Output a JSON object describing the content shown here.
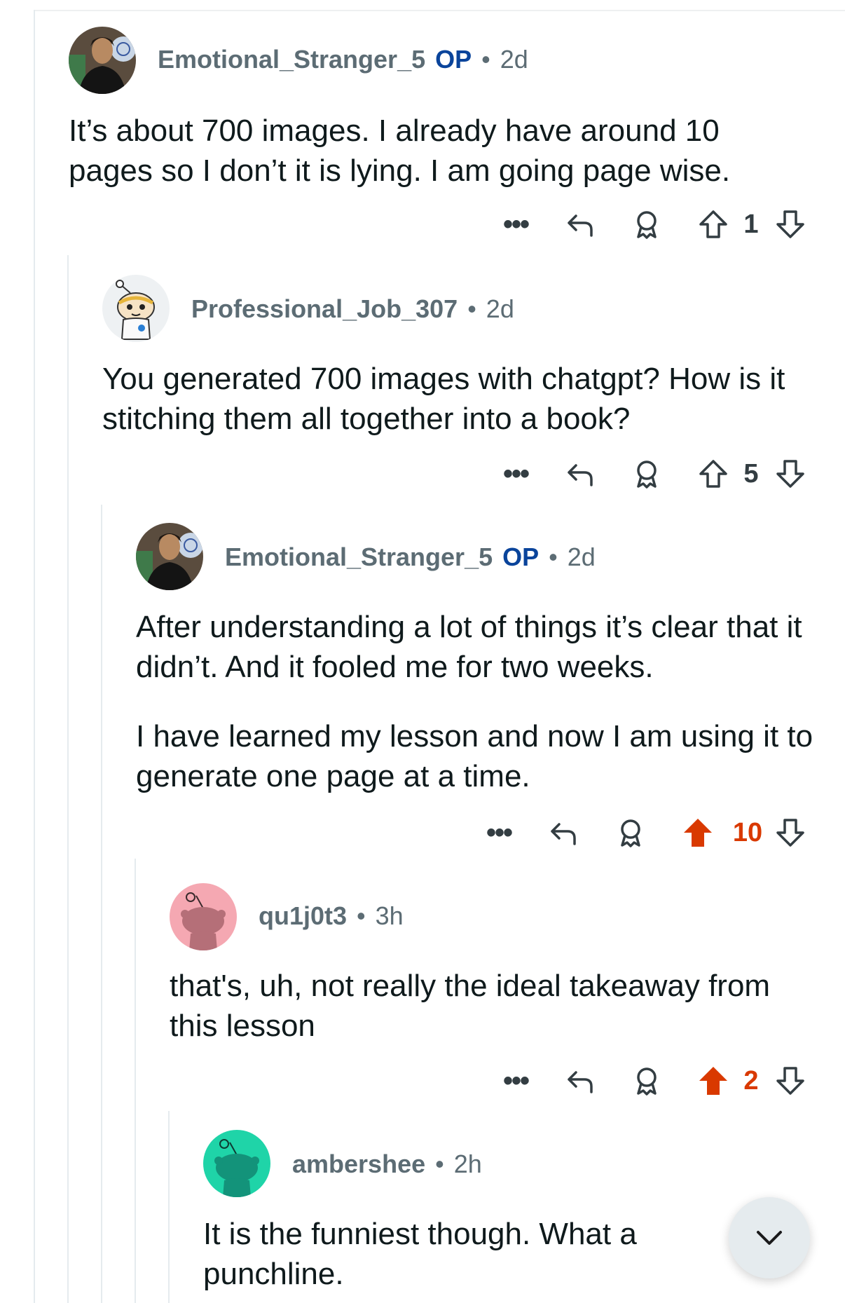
{
  "comments": [
    {
      "author": "Emotional_Stranger_5",
      "op_label": "OP",
      "separator": "•",
      "age": "2d",
      "avatar": "profile-photo",
      "paragraphs": [
        "It’s about 700 images. I already have around 10 pages so I don’t it is lying. I am going page wise."
      ],
      "score": "1",
      "upvoted": false
    },
    {
      "author": "Professional_Job_307",
      "op_label": "",
      "separator": "•",
      "age": "2d",
      "avatar": "snoo-avatar",
      "paragraphs": [
        "You generated 700 images with chatgpt? How is it stitching them all together into a book?"
      ],
      "score": "5",
      "upvoted": false
    },
    {
      "author": "Emotional_Stranger_5",
      "op_label": "OP",
      "separator": "•",
      "age": "2d",
      "avatar": "profile-photo",
      "paragraphs": [
        "After understanding a lot of things it’s clear that it didn’t. And it fooled me for two weeks.",
        "I have learned my lesson and now I am using it to generate one page at a time."
      ],
      "score": "10",
      "upvoted": true
    },
    {
      "author": "qu1j0t3",
      "op_label": "",
      "separator": "•",
      "age": "3h",
      "avatar": "default-snoo-pink",
      "paragraphs": [
        "that's, uh, not really the ideal takeaway from this lesson"
      ],
      "score": "2",
      "upvoted": true
    },
    {
      "author": "ambershee",
      "op_label": "",
      "separator": "•",
      "age": "2h",
      "avatar": "default-snoo-teal",
      "paragraphs": [
        "It is the funniest though. What a punchline."
      ],
      "score": "",
      "upvoted": false
    }
  ],
  "colors": {
    "upvote_active": "#d93900",
    "op_label": "#0a449b",
    "meta_text": "#5c6c74",
    "thread_line": "#e5ebee",
    "snoo_pink_bg": "#f5a8b2",
    "snoo_teal_bg": "#1fd4a8"
  },
  "icons": {
    "more": "more-dots-icon",
    "reply": "reply-arrow-icon",
    "award": "award-icon",
    "upvote": "upvote-arrow-icon",
    "downvote": "downvote-arrow-icon",
    "scroll": "chevron-down-icon"
  }
}
